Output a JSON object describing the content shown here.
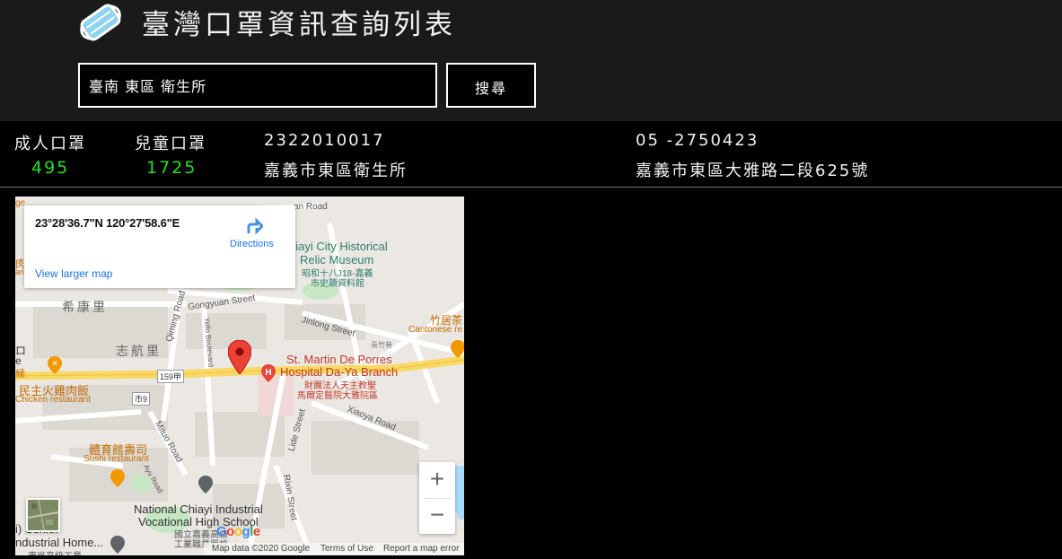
{
  "header": {
    "title": "臺灣口罩資訊查詢列表",
    "logo_icon": "mask-icon"
  },
  "search": {
    "value": "臺南 東區 衛生所",
    "button_label": "搜尋"
  },
  "result": {
    "adult_label": "成人口罩",
    "adult_count": "495",
    "child_label": "兒童口罩",
    "child_count": "1725",
    "code": "2322010017",
    "name": "嘉義市東區衛生所",
    "phone": "05 -2750423",
    "address": "嘉義市東區大雅路二段625號"
  },
  "map": {
    "coords": "23°28'36.7\"N 120°27'58.6\"E",
    "directions_label": "Directions",
    "larger_map_label": "View larger map",
    "zoom_in_label": "+",
    "zoom_out_label": "−",
    "attribution": "Map data ©2020 Google",
    "terms": "Terms of Use",
    "report": "Report a map error",
    "google_logo": "Google",
    "labels": {
      "museum_en_1": "hiayi City Historical",
      "museum_en_2": "Relic Museum",
      "museum_zh_1": "昭和十八J18-嘉義",
      "museum_zh_2": "市史蹟資料館",
      "xikangli": "希康里",
      "zhihangli": "志航里",
      "gongyuan": "Gongyuan Street",
      "qiming": "Qiming Road",
      "yello": "Yello Boulevard",
      "jinlong": "Jinlong Street",
      "road_top": "an Road",
      "restaurant_zh_1": "竹居茶",
      "restaurant_en_1": "Cantonese re",
      "alley": "長竹巷",
      "hospital_en_1": "St. Martin De Porres",
      "hospital_en_2": "Hospital Da-Ya Branch",
      "hospital_zh_1": "財團法人天主教聖",
      "hospital_zh_2": "馬爾定醫院大雅院區",
      "route159": "159甲",
      "route9": "市9",
      "chicken_zh": "民主火雞肉飯",
      "chicken_en": "Chicken restaurant",
      "xiaoya": "Xiaoya Road",
      "lide": "Lide Street",
      "mituo": "Mituo Road",
      "sushi_zh": "體育館壽司",
      "sushi_en": "Sushi restaurant",
      "ayu": "Ayu Road",
      "school_en_1": "National Chiayi Industrial",
      "school_en_2": "Vocational High School",
      "school_zh": "國立嘉義高級",
      "school_zh_2": "工業職業學校",
      "rixin": "Rixin Street",
      "senior_1": "i) Senior",
      "senior_2": "ndustrial Home...",
      "senior_zh": "東吳高級工業",
      "left_1": "ge",
      "left_2": "肉",
      "left_3": "ant",
      "left_4": "ロ",
      "left_5": "e",
      "left_6": "候"
    }
  },
  "colors": {
    "header_bg": "#1a1a1a",
    "count_green": "#22e022",
    "accent_blue": "#1a73e8",
    "pin_red": "#d93025",
    "road_yellow": "#f9d966"
  }
}
